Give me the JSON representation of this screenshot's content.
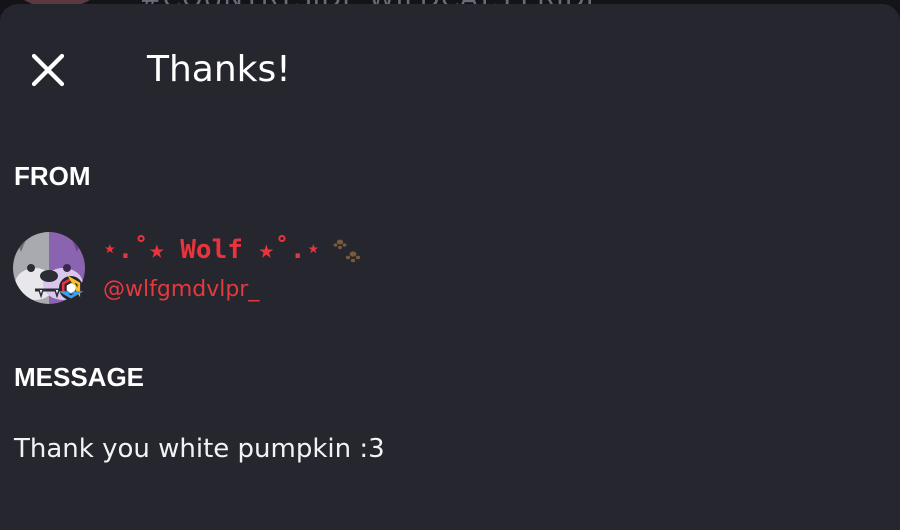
{
  "backdrop": {
    "header_text": "#COUNTRYSIDE WILDCATS PRIDE"
  },
  "dialog": {
    "title": "Thanks!",
    "close_icon": "close-icon"
  },
  "sender": {
    "section_label": "FROM",
    "display_name": "⋆.˚★ Wolf ★˚.⋆",
    "username": "@wlfgmdvlpr_",
    "avatar_icon": "wolf-avatar",
    "badge_icon": "hexagon-badge-icon",
    "paw_icon": "paw-prints-icon"
  },
  "message": {
    "section_label": "MESSAGE",
    "text": "Thank you white pumpkin :3"
  },
  "colors": {
    "sheet_background": "#26262f",
    "name_accent": "#e8343c",
    "username": "#e23a3f",
    "text": "#ffffff"
  }
}
